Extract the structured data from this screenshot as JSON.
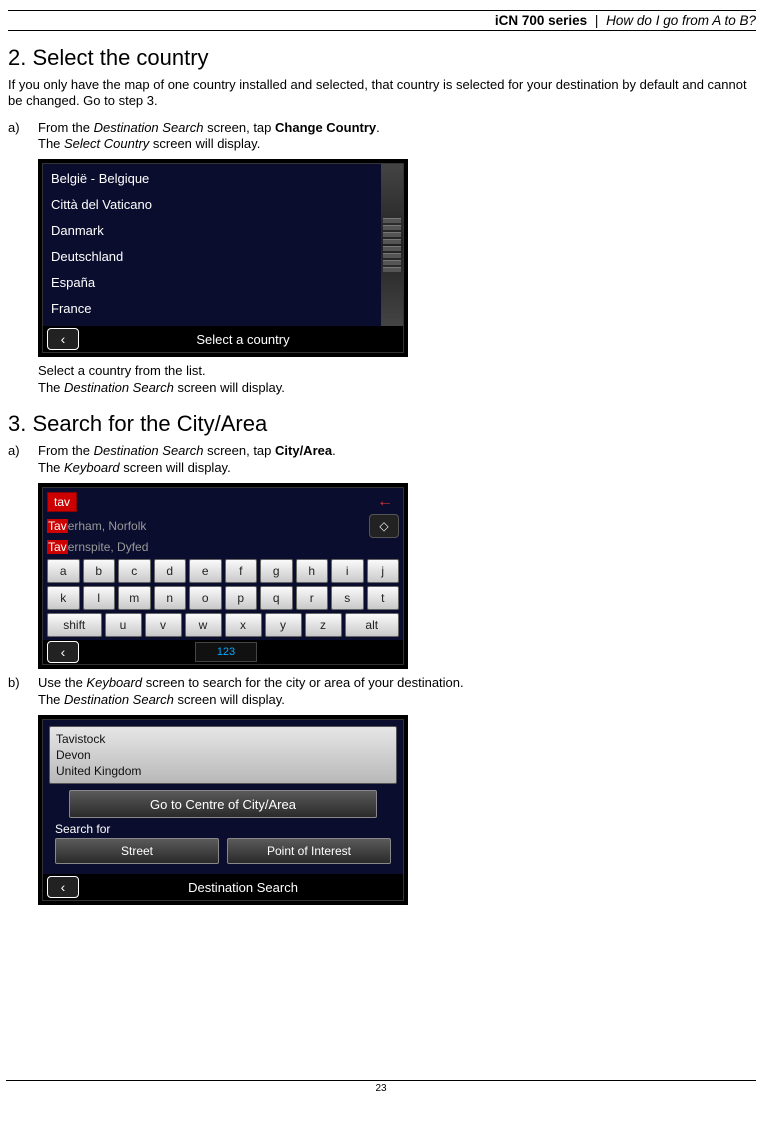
{
  "header": {
    "product": "iCN 700 series",
    "divider": "|",
    "section": "How do I go from A to B?"
  },
  "s2": {
    "title": "2. Select the country",
    "intro": "If you only have the map of one country installed and selected, that country is selected for your destination by default and cannot be changed. Go to step 3.",
    "a": {
      "label": "a)",
      "l1": "From the ",
      "i1": "Destination Search",
      "l2": " screen, tap ",
      "b1": "Change Country",
      "l3": ".",
      "l4": "The ",
      "i2": "Select Country",
      "l5": " screen will display."
    },
    "countries": [
      "België - Belgique",
      "Città del Vaticano",
      "Danmark",
      "Deutschland",
      "España",
      "France"
    ],
    "screenshot_footer": "Select a country",
    "back_icon": "‹",
    "after1": "Select a country from the list.",
    "after2a": "The ",
    "after2i": "Destination Search",
    "after2b": " screen will display."
  },
  "s3": {
    "title": "3. Search for the City/Area",
    "a": {
      "label": "a)",
      "l1": "From the ",
      "i1": "Destination Search",
      "l2": " screen, tap ",
      "b1": "City/Area",
      "l3": ".",
      "l4": "The ",
      "i2": "Keyboard",
      "l5": " screen will display."
    },
    "kbd": {
      "typed": "tav",
      "sugg": [
        {
          "hl": "Tav",
          "rest": "erham, Norfolk"
        },
        {
          "hl": "Tav",
          "rest": "ernspite, Dyfed"
        }
      ],
      "arrow": "←",
      "updown": "◇",
      "row1": [
        "a",
        "b",
        "c",
        "d",
        "e",
        "f",
        "g",
        "h",
        "i",
        "j"
      ],
      "row2": [
        "k",
        "l",
        "m",
        "n",
        "o",
        "p",
        "q",
        "r",
        "s",
        "t"
      ],
      "row3": [
        "shift",
        "u",
        "v",
        "w",
        "x",
        "y",
        "z",
        "alt"
      ],
      "num": "123",
      "back": "‹"
    },
    "b": {
      "label": "b)",
      "l1": "Use the ",
      "i1": "Keyboard",
      "l2": " screen to search for the city or area of your destination.",
      "l3": "The ",
      "i2": "Destination Search",
      "l4": " screen will display."
    },
    "ds": {
      "lines": [
        "Tavistock",
        "Devon",
        "United Kingdom"
      ],
      "big": "Go to Centre of City/Area",
      "searchfor": "Search for",
      "street": "Street",
      "poi": "Point of Interest",
      "footer": "Destination Search",
      "back": "‹"
    }
  },
  "page_number": "23"
}
